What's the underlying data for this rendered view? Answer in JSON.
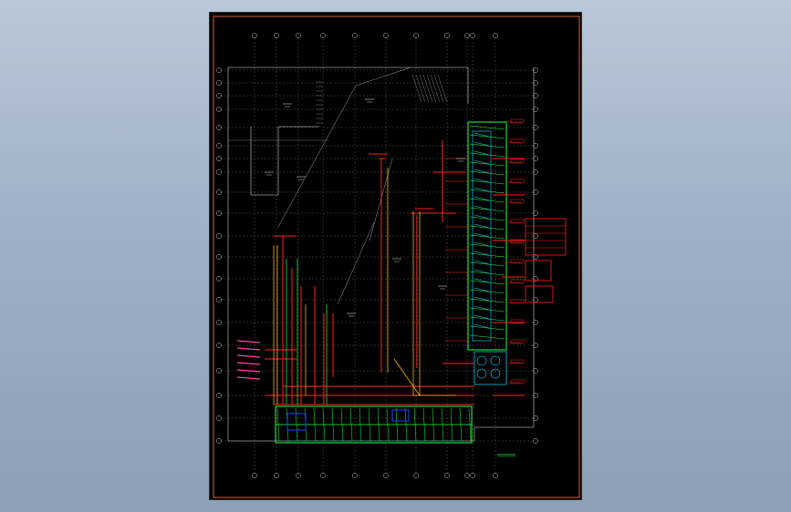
{
  "canvas": {
    "background_gradient_top": "#b9c8d8",
    "background_gradient_bottom": "#8d9fb5",
    "sheet_background": "#000000",
    "frame_color": "#e0603a"
  },
  "drawing": {
    "grid_color": "#7a7a7a",
    "wall_color": "#9a9a9a",
    "pipe_red": "#ff2020",
    "pipe_green": "#20ff40",
    "pipe_cyan": "#00e0ff",
    "pipe_yellow": "#ffb000",
    "pipe_magenta": "#ff40a0",
    "label_color": "#c8c8c8"
  },
  "icons": {
    "title_block": "legend-table",
    "grid_bubble": "circle-bubble"
  }
}
